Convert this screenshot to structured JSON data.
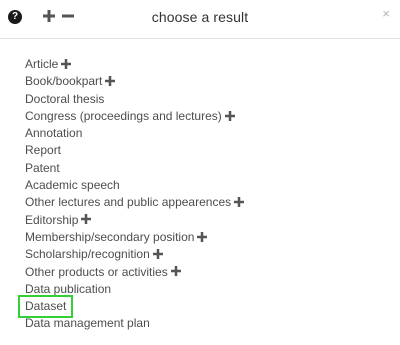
{
  "dialog": {
    "title": "choose a result",
    "help_glyph": "?",
    "close_glyph": "×"
  },
  "items": [
    {
      "label": "Article",
      "expandable": true
    },
    {
      "label": "Book/bookpart",
      "expandable": true
    },
    {
      "label": "Doctoral thesis",
      "expandable": false
    },
    {
      "label": "Congress (proceedings and lectures)",
      "expandable": true
    },
    {
      "label": "Annotation",
      "expandable": false
    },
    {
      "label": "Report",
      "expandable": false
    },
    {
      "label": "Patent",
      "expandable": false
    },
    {
      "label": "Academic speech",
      "expandable": false
    },
    {
      "label": "Other lectures and public appearences",
      "expandable": true
    },
    {
      "label": "Editorship",
      "expandable": true
    },
    {
      "label": "Membership/secondary position",
      "expandable": true
    },
    {
      "label": "Scholarship/recognition",
      "expandable": true
    },
    {
      "label": "Other products or activities",
      "expandable": true
    },
    {
      "label": "Data publication",
      "expandable": false
    },
    {
      "label": "Dataset",
      "expandable": false,
      "selected": true
    },
    {
      "label": "Data management plan",
      "expandable": false
    }
  ],
  "colors": {
    "selection_outline": "#35d035",
    "icon": "#555555",
    "text": "#4d4d4d"
  },
  "icons": {
    "help": "question-circle-icon",
    "expand_all": "plus-icon",
    "collapse_all": "minus-icon",
    "close": "close-icon",
    "item_expand": "plus-icon"
  }
}
